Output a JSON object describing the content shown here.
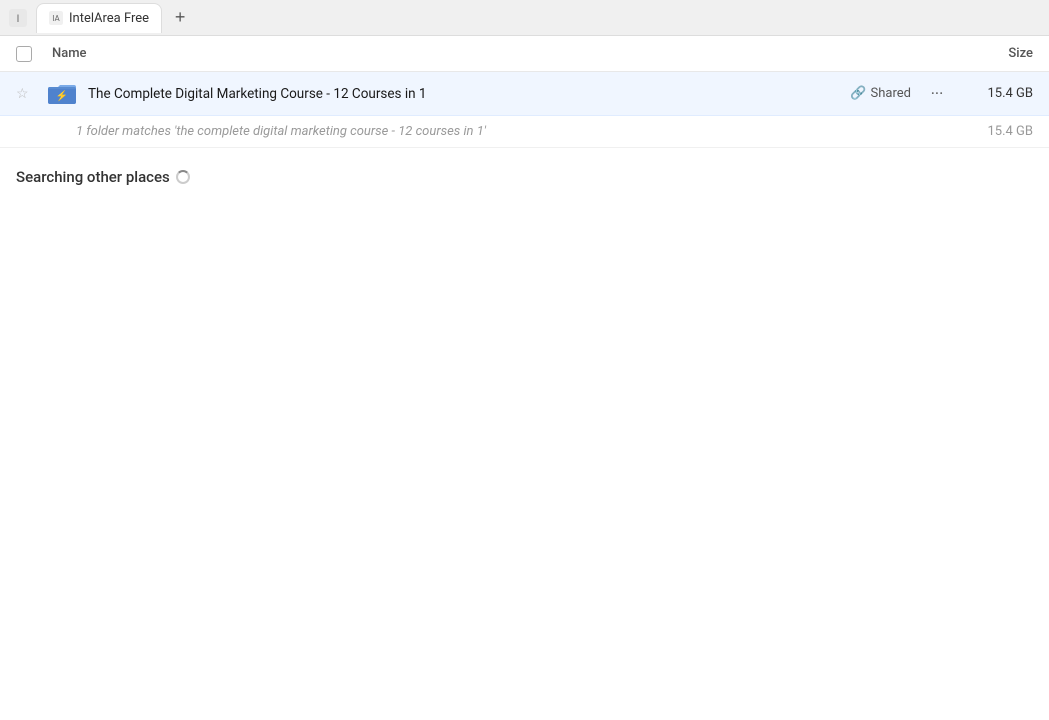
{
  "tab_bar": {
    "app_name": "IntelArea Free",
    "new_tab_icon": "+",
    "tab_label": "IntelArea Free"
  },
  "columns": {
    "name_label": "Name",
    "size_label": "Size"
  },
  "file_row": {
    "file_name": "The Complete Digital Marketing Course - 12 Courses in 1",
    "shared_label": "Shared",
    "file_size": "15.4 GB",
    "more_icon": "···"
  },
  "summary": {
    "text": "1 folder matches 'the complete digital marketing course - 12 courses in 1'",
    "size": "15.4 GB"
  },
  "searching": {
    "label": "Searching other places"
  }
}
